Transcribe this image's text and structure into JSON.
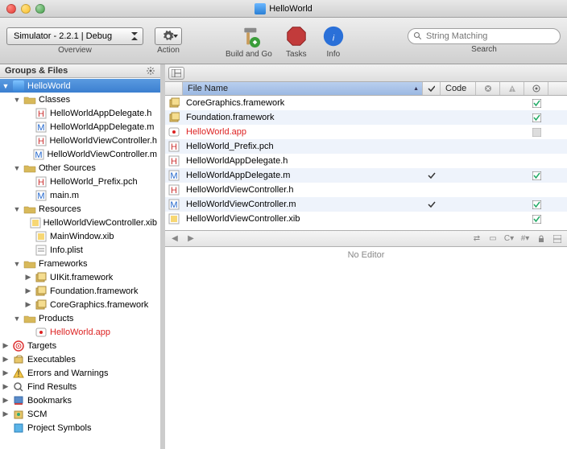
{
  "window": {
    "title": "HelloWorld"
  },
  "toolbar": {
    "overview": {
      "label": "Overview",
      "selector_text": "Simulator - 2.2.1 | Debug"
    },
    "action": {
      "label": "Action"
    },
    "build": {
      "label": "Build and Go"
    },
    "tasks": {
      "label": "Tasks"
    },
    "info": {
      "label": "Info"
    },
    "search": {
      "label": "Search",
      "placeholder": "String Matching"
    }
  },
  "sidebar": {
    "header": "Groups & Files",
    "tree": [
      {
        "label": "HelloWorld",
        "type": "project",
        "depth": 0,
        "expanded": true,
        "selected": true
      },
      {
        "label": "Classes",
        "type": "folder",
        "depth": 1,
        "expanded": true
      },
      {
        "label": "HelloWorldAppDelegate.h",
        "type": "h",
        "depth": 2
      },
      {
        "label": "HelloWorldAppDelegate.m",
        "type": "m",
        "depth": 2
      },
      {
        "label": "HelloWorldViewController.h",
        "type": "h",
        "depth": 2
      },
      {
        "label": "HelloWorldViewController.m",
        "type": "m",
        "depth": 2
      },
      {
        "label": "Other Sources",
        "type": "folder",
        "depth": 1,
        "expanded": true
      },
      {
        "label": "HelloWorld_Prefix.pch",
        "type": "h",
        "depth": 2
      },
      {
        "label": "main.m",
        "type": "m",
        "depth": 2
      },
      {
        "label": "Resources",
        "type": "folder",
        "depth": 1,
        "expanded": true
      },
      {
        "label": "HelloWorldViewController.xib",
        "type": "xib",
        "depth": 2
      },
      {
        "label": "MainWindow.xib",
        "type": "xib",
        "depth": 2
      },
      {
        "label": "Info.plist",
        "type": "plist",
        "depth": 2
      },
      {
        "label": "Frameworks",
        "type": "folder",
        "depth": 1,
        "expanded": true
      },
      {
        "label": "UIKit.framework",
        "type": "framework",
        "depth": 2
      },
      {
        "label": "Foundation.framework",
        "type": "framework",
        "depth": 2
      },
      {
        "label": "CoreGraphics.framework",
        "type": "framework",
        "depth": 2
      },
      {
        "label": "Products",
        "type": "folder",
        "depth": 1,
        "expanded": true
      },
      {
        "label": "HelloWorld.app",
        "type": "app",
        "depth": 2,
        "red": true
      },
      {
        "label": "Targets",
        "type": "targets",
        "depth": 0
      },
      {
        "label": "Executables",
        "type": "executables",
        "depth": 0
      },
      {
        "label": "Errors and Warnings",
        "type": "errors",
        "depth": 0
      },
      {
        "label": "Find Results",
        "type": "find",
        "depth": 0
      },
      {
        "label": "Bookmarks",
        "type": "bookmarks",
        "depth": 0
      },
      {
        "label": "SCM",
        "type": "scm",
        "depth": 0
      },
      {
        "label": "Project Symbols",
        "type": "symbols",
        "depth": 0
      }
    ]
  },
  "table": {
    "columns": {
      "name": "File Name",
      "code": "Code"
    },
    "rows": [
      {
        "name": "CoreGraphics.framework",
        "type": "framework",
        "target": true
      },
      {
        "name": "Foundation.framework",
        "type": "framework",
        "target": true
      },
      {
        "name": "HelloWorld.app",
        "type": "app",
        "red": true,
        "target_disabled": true
      },
      {
        "name": "HelloWorld_Prefix.pch",
        "type": "h"
      },
      {
        "name": "HelloWorldAppDelegate.h",
        "type": "h"
      },
      {
        "name": "HelloWorldAppDelegate.m",
        "type": "m",
        "check": true,
        "target": true
      },
      {
        "name": "HelloWorldViewController.h",
        "type": "h"
      },
      {
        "name": "HelloWorldViewController.m",
        "type": "m",
        "check": true,
        "target": true
      },
      {
        "name": "HelloWorldViewController.xib",
        "type": "xib",
        "target": true
      }
    ]
  },
  "editor": {
    "placeholder": "No Editor"
  }
}
